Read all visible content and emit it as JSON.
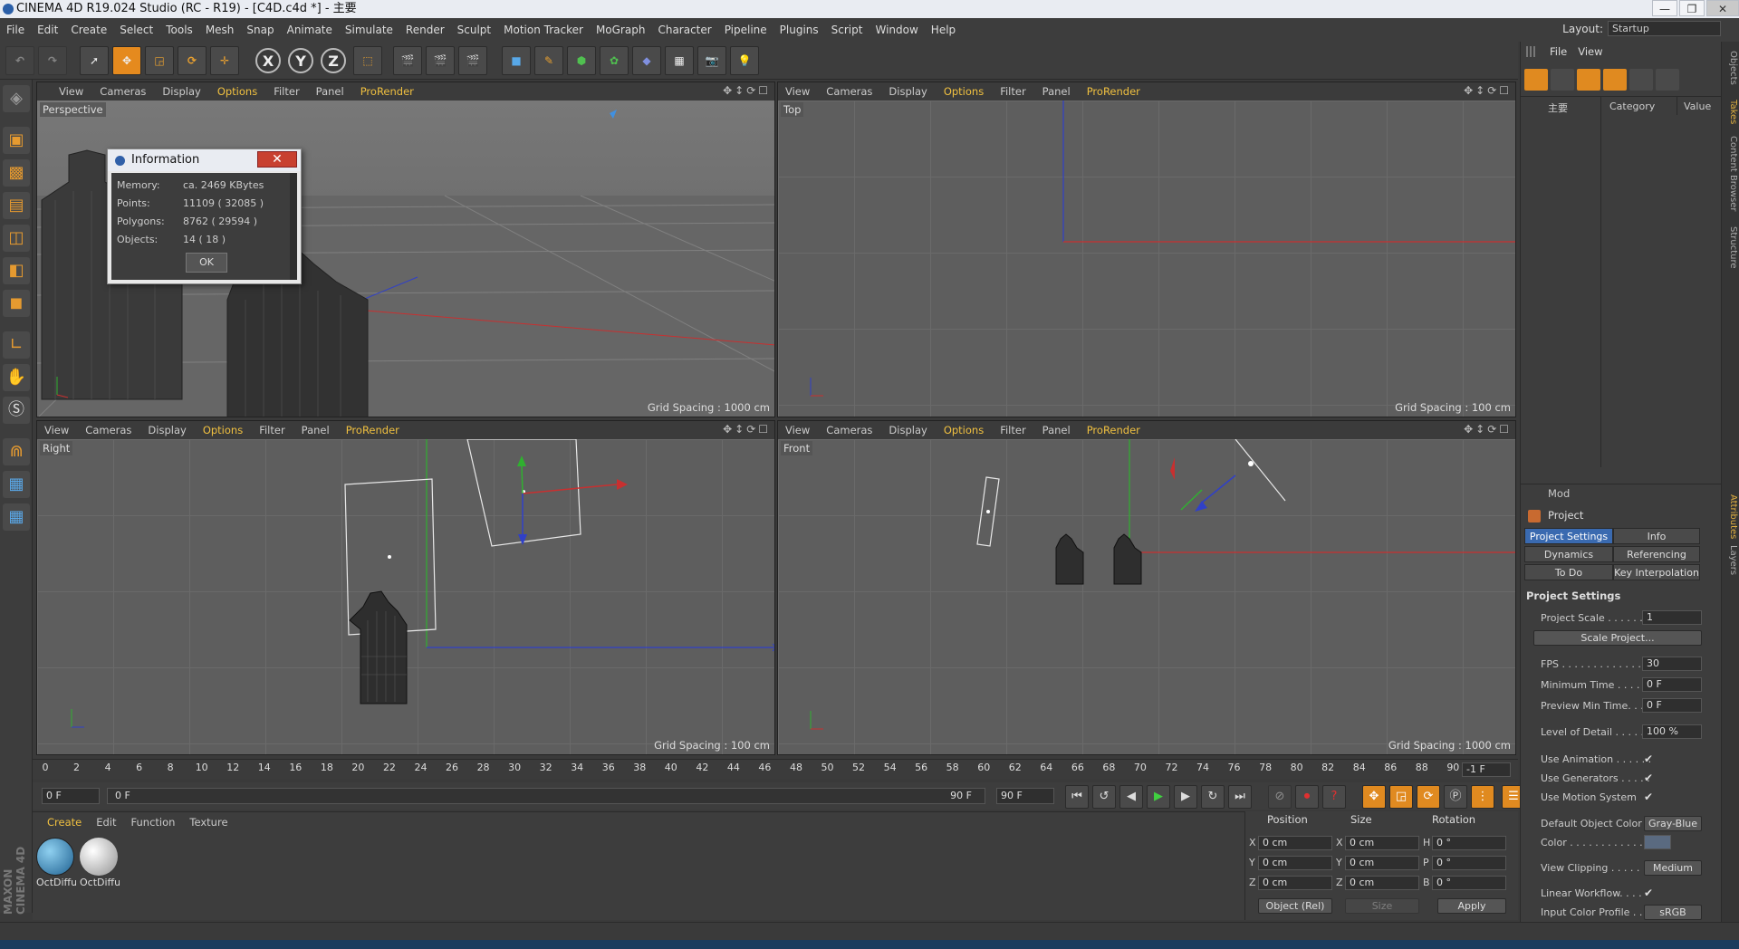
{
  "window": {
    "title": "CINEMA 4D R19.024 Studio (RC - R19) - [C4D.c4d *] - 主要",
    "buttons": [
      "—",
      "❐",
      "✕"
    ]
  },
  "menu": [
    "File",
    "Edit",
    "Create",
    "Select",
    "Tools",
    "Mesh",
    "Snap",
    "Animate",
    "Simulate",
    "Render",
    "Sculpt",
    "Motion Tracker",
    "MoGraph",
    "Character",
    "Pipeline",
    "Plugins",
    "Script",
    "Window",
    "Help"
  ],
  "layout": {
    "label": "Layout:",
    "value": "Startup"
  },
  "toolbar": {
    "x": "X",
    "y": "Y",
    "z": "Z"
  },
  "viewport_menu": [
    "View",
    "Cameras",
    "Display",
    "Options",
    "Filter",
    "Panel",
    "ProRender"
  ],
  "viewports": {
    "perspective": {
      "label": "Perspective",
      "grid": "Grid Spacing : 1000 cm"
    },
    "top": {
      "label": "Top",
      "grid": "Grid Spacing : 100 cm"
    },
    "right": {
      "label": "Right",
      "grid": "Grid Spacing : 100 cm"
    },
    "front": {
      "label": "Front",
      "grid": "Grid Spacing : 1000 cm"
    }
  },
  "info_dialog": {
    "title": "Information",
    "close": "✕",
    "rows": [
      {
        "k": "Memory:",
        "v": "ca. 2469 KBytes"
      },
      {
        "k": "Points:",
        "v": "11109 ( 32085 )"
      },
      {
        "k": "Polygons:",
        "v": "8762 ( 29594 )"
      },
      {
        "k": "Objects:",
        "v": "14 ( 18 )"
      }
    ],
    "ok": "OK"
  },
  "timeline": {
    "ticks": [
      "0",
      "2",
      "4",
      "6",
      "8",
      "10",
      "12",
      "14",
      "16",
      "18",
      "20",
      "22",
      "24",
      "26",
      "28",
      "30",
      "32",
      "34",
      "36",
      "38",
      "40",
      "42",
      "44",
      "46",
      "48",
      "50",
      "52",
      "54",
      "56",
      "58",
      "60",
      "62",
      "64",
      "66",
      "68",
      "70",
      "72",
      "74",
      "76",
      "78",
      "80",
      "82",
      "84",
      "86",
      "88",
      "90"
    ],
    "current": "-1 F",
    "start": "0 F",
    "slider_start": "0 F",
    "slider_end": "90 F",
    "end": "90 F"
  },
  "materials": {
    "menu": [
      "Create",
      "Edit",
      "Function",
      "Texture"
    ],
    "items": [
      {
        "name": "OctDiffu"
      },
      {
        "name": "OctDiffu"
      }
    ]
  },
  "coordinates": {
    "headers": [
      "Position",
      "Size",
      "Rotation"
    ],
    "rows": [
      {
        "a": "X",
        "pos": "0 cm",
        "b": "X",
        "size": "0 cm",
        "c": "H",
        "rot": "0 °"
      },
      {
        "a": "Y",
        "pos": "0 cm",
        "b": "Y",
        "size": "0 cm",
        "c": "P",
        "rot": "0 °"
      },
      {
        "a": "Z",
        "pos": "0 cm",
        "b": "Z",
        "size": "0 cm",
        "c": "B",
        "rot": "0 °"
      }
    ],
    "mode": "Object (Rel)",
    "size_mode": "Size",
    "apply": "Apply"
  },
  "objects": {
    "menu": [
      "File",
      "View"
    ],
    "root": "主要",
    "columns": [
      "Category",
      "Value"
    ]
  },
  "attributes": {
    "mode": "Mod",
    "project": "Project",
    "tabs": [
      "Project Settings",
      "Info",
      "Dynamics",
      "Referencing",
      "To Do",
      "Key Interpolation"
    ],
    "section": "Project Settings",
    "rows": {
      "scale_label": "Project Scale . . . . . . .",
      "scale_value": "1",
      "scale_btn": "Scale Project...",
      "fps_label": "FPS . . . . . . . . . . . . . .",
      "fps_value": "30",
      "mintime_label": "Minimum Time . . . . . .",
      "mintime_value": "0 F",
      "prevmin_label": "Preview Min Time. . . .",
      "prevmin_value": "0 F",
      "lod_label": "Level of Detail . . . . . .",
      "lod_value": "100 %",
      "anim_label": "Use Animation . . . . . .",
      "gen_label": "Use Generators . . . . .",
      "motion_label": "Use Motion System",
      "defcolor_label": "Default Object Color",
      "defcolor_value": "Gray-Blue",
      "color_label": "Color . . . . . . . . . . . .",
      "clip_label": "View Clipping . . . . . .",
      "clip_value": "Medium",
      "linear_label": "Linear Workflow. . . .",
      "profile_label": "Input Color Profile . . .",
      "profile_value": "sRGB"
    }
  },
  "side_tabs": [
    "Objects",
    "Takes",
    "Content Browser",
    "Structure",
    "Attributes",
    "Layers"
  ],
  "maxon": "MAXON CINEMA 4D",
  "colors": {
    "accent": "#f0c040",
    "selected_tab": "#3a6ab0",
    "x_axis": "#c83030",
    "y_axis": "#30b030",
    "z_axis": "#3040c8"
  }
}
